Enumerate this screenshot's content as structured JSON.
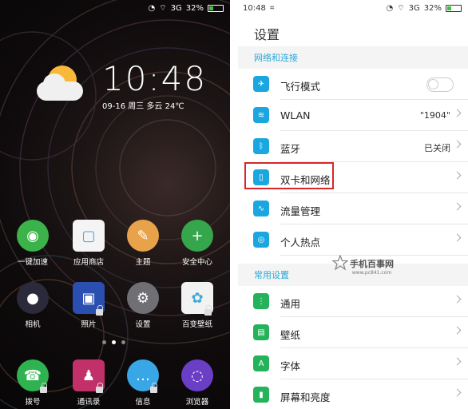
{
  "home": {
    "status": {
      "time": "",
      "signal": "3G",
      "battery": "32%"
    },
    "clock": "10:48",
    "date": "09-16 周三 多云 24℃",
    "apps": [
      {
        "label": "一键加速",
        "icon": "speedup-icon",
        "color": "#3bb34a"
      },
      {
        "label": "应用商店",
        "icon": "app-store-icon",
        "color": "#f4f4f4"
      },
      {
        "label": "主题",
        "icon": "theme-brush-icon",
        "color": "#e8a24a"
      },
      {
        "label": "安全中心",
        "icon": "security-shield-icon",
        "color": "#35a64c"
      },
      {
        "label": "相机",
        "icon": "camera-icon",
        "color": "#2a2a3a"
      },
      {
        "label": "照片",
        "icon": "photos-icon",
        "color": "#2b4fb0"
      },
      {
        "label": "设置",
        "icon": "settings-gear-icon",
        "color": "#6f6f74"
      },
      {
        "label": "百变壁纸",
        "icon": "wallpaper-icon",
        "color": "#f2f2f2"
      },
      {
        "label": "拨号",
        "icon": "phone-icon",
        "color": "#2fb250"
      },
      {
        "label": "通讯录",
        "icon": "contacts-icon",
        "color": "#c2306a"
      },
      {
        "label": "信息",
        "icon": "messages-icon",
        "color": "#39a7e6"
      },
      {
        "label": "浏览器",
        "icon": "browser-icon",
        "color": "#6b3ec6"
      }
    ]
  },
  "settings": {
    "status": {
      "time": "10:48",
      "signal": "3G",
      "battery": "32%"
    },
    "title": "设置",
    "section1": "网络和连接",
    "section2": "常用设置",
    "rows1": [
      {
        "label": "飞行模式",
        "value": "",
        "icon": "airplane-icon",
        "toggle": true
      },
      {
        "label": "WLAN",
        "value": "\"1904\"",
        "icon": "wifi-icon"
      },
      {
        "label": "蓝牙",
        "value": "已关闭",
        "icon": "bluetooth-icon"
      },
      {
        "label": "双卡和网络",
        "value": "",
        "icon": "dual-sim-icon"
      },
      {
        "label": "流量管理",
        "value": "",
        "icon": "data-usage-icon"
      },
      {
        "label": "个人热点",
        "value": "",
        "icon": "hotspot-icon"
      }
    ],
    "rows2": [
      {
        "label": "通用",
        "value": "",
        "icon": "general-icon"
      },
      {
        "label": "壁纸",
        "value": "",
        "icon": "wallpaper-setting-icon"
      },
      {
        "label": "字体",
        "value": "",
        "icon": "font-icon"
      },
      {
        "label": "屏幕和亮度",
        "value": "",
        "icon": "display-brightness-icon"
      }
    ]
  },
  "watermark": {
    "title": "手机百事网",
    "url": "www.pc841.com"
  },
  "colors": {
    "accent": "#28a8d8",
    "highlight": "#d6262a",
    "icon_blue": "#1aa7e0",
    "icon_green": "#24b35a"
  }
}
